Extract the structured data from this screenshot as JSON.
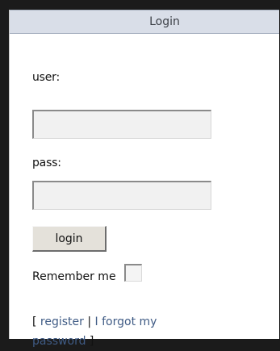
{
  "header": {
    "title": "Login"
  },
  "form": {
    "user_label": "user:",
    "user_value": "",
    "pass_label": "pass:",
    "pass_value": "",
    "login_button": "login",
    "remember_label": "Remember me"
  },
  "links": {
    "open_bracket": "[",
    "register": "register",
    "separator": "|",
    "forgot": "I forgot my password",
    "close_bracket": "]"
  },
  "colors": {
    "header_bg": "#d9dee8",
    "link": "#3f5b85"
  }
}
